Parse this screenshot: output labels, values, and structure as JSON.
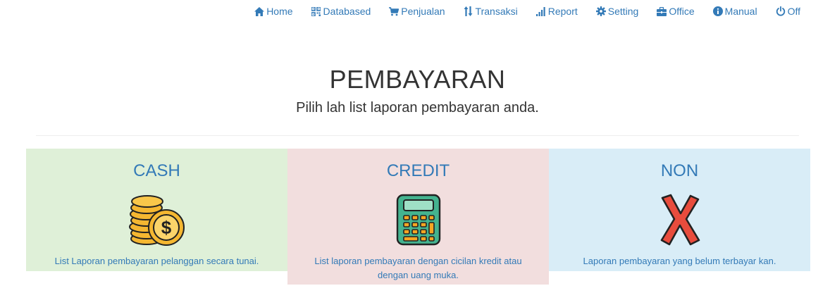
{
  "nav": {
    "items": [
      {
        "label": "Home",
        "icon": "home-icon"
      },
      {
        "label": "Databased",
        "icon": "qrcode-icon"
      },
      {
        "label": "Penjualan",
        "icon": "shopping-cart-icon"
      },
      {
        "label": "Transaksi",
        "icon": "sort-arrows-icon"
      },
      {
        "label": "Report",
        "icon": "signal-bars-icon"
      },
      {
        "label": "Setting",
        "icon": "cog-icon"
      },
      {
        "label": "Office",
        "icon": "briefcase-icon"
      },
      {
        "label": "Manual",
        "icon": "info-circle-icon"
      },
      {
        "label": "Off",
        "icon": "power-icon"
      }
    ],
    "link_color": "#337ab7"
  },
  "header": {
    "title": "PEMBAYARAN",
    "subtitle": "Pilih lah list laporan pembayaran anda."
  },
  "cards": [
    {
      "title": "CASH",
      "description": "List Laporan pembayaran pelanggan secara tunai.",
      "icon": "coins-icon",
      "bg": "#dff0d8"
    },
    {
      "title": "CREDIT",
      "description": "List laporan pembayaran dengan cicilan kredit atau dengan uang muka.",
      "icon": "calculator-icon",
      "bg": "#f2dede"
    },
    {
      "title": "NON",
      "description": "Laporan pembayaran yang belum terbayar kan.",
      "icon": "cross-x-icon",
      "bg": "#d9edf7"
    }
  ]
}
